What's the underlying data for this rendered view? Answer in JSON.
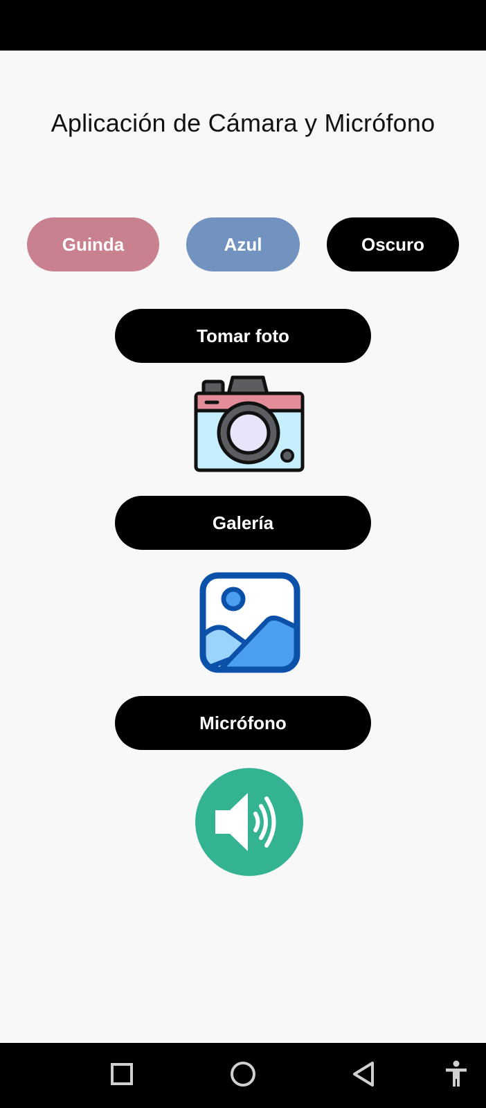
{
  "header": {
    "title": "Aplicación de Cámara y Micrófono"
  },
  "themes": {
    "guinda": {
      "label": "Guinda",
      "color": "#c98190"
    },
    "azul": {
      "label": "Azul",
      "color": "#7293bf"
    },
    "oscuro": {
      "label": "Oscuro",
      "color": "#000000"
    }
  },
  "actions": {
    "take_photo": {
      "label": "Tomar foto",
      "icon": "camera-icon"
    },
    "gallery": {
      "label": "Galería",
      "icon": "gallery-icon"
    },
    "microphone": {
      "label": "Micrófono",
      "icon": "speaker-icon"
    }
  },
  "navigation": {
    "items": [
      "recents-icon",
      "home-icon",
      "back-icon",
      "accessibility-icon"
    ]
  }
}
